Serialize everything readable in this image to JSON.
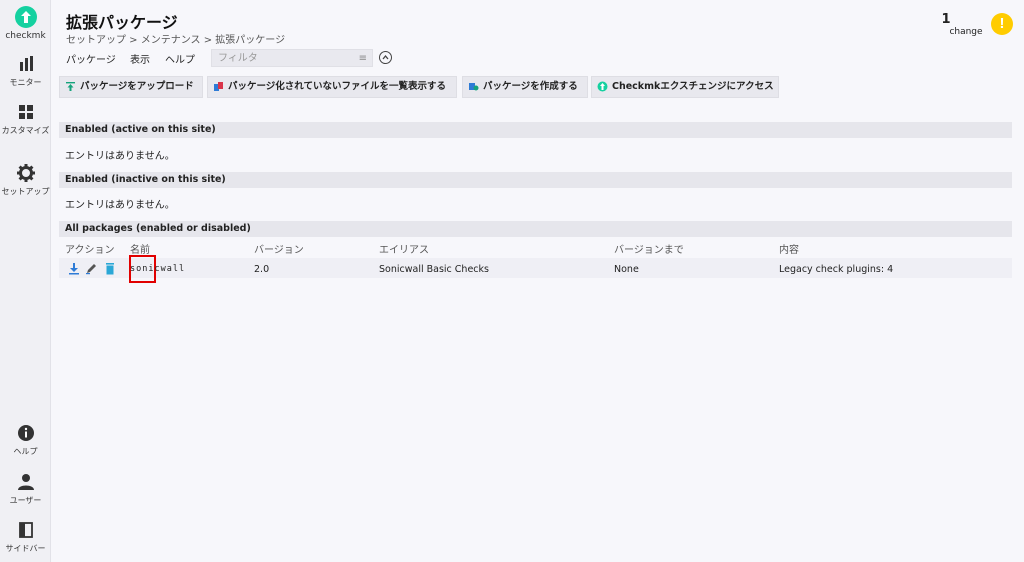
{
  "sidebar": {
    "logo": "checkmk",
    "items": [
      {
        "label": "モニター",
        "icon": "bar-chart-icon"
      },
      {
        "label": "カスタマイズ",
        "icon": "grid-icon"
      },
      {
        "label": "セットアップ",
        "icon": "gear-icon"
      },
      {
        "label": "ヘルプ",
        "icon": "info-icon"
      },
      {
        "label": "ユーザー",
        "icon": "user-icon"
      },
      {
        "label": "サイドバー",
        "icon": "sidebar-icon"
      }
    ]
  },
  "header": {
    "title": "拡張パッケージ",
    "breadcrumb": "セットアップ > メンテナンス > 拡張パッケージ",
    "change_count": "1",
    "change_label": "change",
    "warning_icon": "exclamation-icon",
    "warning_color": "#ffcc00"
  },
  "menubar": {
    "items": [
      "パッケージ",
      "表示",
      "ヘルプ"
    ],
    "filter_placeholder": "フィルタ"
  },
  "toolbar": {
    "buttons": [
      {
        "label": "パッケージをアップロード",
        "icon": "upload-icon"
      },
      {
        "label": "パッケージ化されていないファイルを一覧表示する",
        "icon": "files-icon"
      },
      {
        "label": "パッケージを作成する",
        "icon": "create-package-icon"
      },
      {
        "label": "Checkmkエクスチェンジにアクセス",
        "icon": "exchange-icon"
      }
    ]
  },
  "sections": {
    "enabled_active": {
      "title": "Enabled (active on this site)",
      "empty": "エントリはありません。"
    },
    "enabled_inactive": {
      "title": "Enabled (inactive on this site)",
      "empty": "エントリはありません。"
    },
    "all": {
      "title": "All packages (enabled or disabled)"
    }
  },
  "table": {
    "columns": [
      "アクション",
      "名前",
      "バージョン",
      "エイリアス",
      "バージョンまで",
      "内容"
    ],
    "rows": [
      {
        "name": "sonicwall",
        "version": "2.0",
        "alias": "Sonicwall Basic Checks",
        "until": "None",
        "content": "Legacy check plugins: 4"
      }
    ]
  },
  "colors": {
    "accent": "#15d1a0",
    "highlight": "#e10000"
  }
}
